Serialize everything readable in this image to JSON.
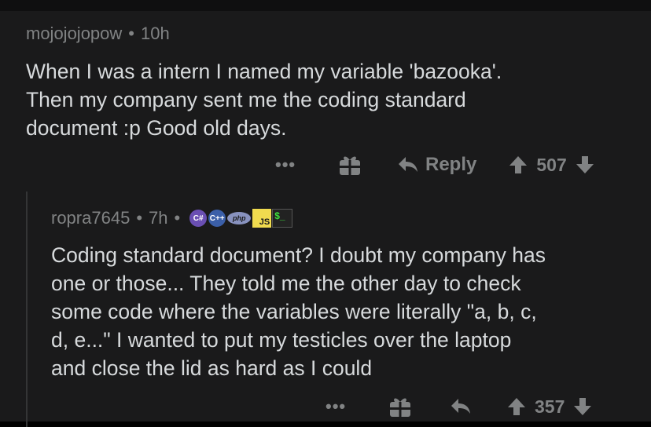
{
  "comment1": {
    "username": "mojojojopow",
    "separator": "•",
    "time": "10h",
    "lines": [
      "When I was a intern I named my variable 'bazooka'.",
      "Then my company sent me the coding standard",
      "document :p Good old days."
    ],
    "more_label": "•••",
    "reply_label": "Reply",
    "score": "507"
  },
  "comment2": {
    "username": "ropra7645",
    "separator": "•",
    "time": "7h",
    "flair": {
      "csharp": "C#",
      "cpp": "C++",
      "php": "php",
      "js": "JS",
      "terminal": "$_"
    },
    "lines": [
      "Coding standard document? I doubt my company has",
      "one or those... They  told me the other day to check",
      "some code where the variables were literally \"a, b, c,",
      "d, e...\" I wanted to put my testicles over the laptop",
      "and close the lid as hard as I could"
    ],
    "more_label": "•••",
    "score": "357"
  },
  "colors": {
    "background": "#1a1a1b",
    "text": "#d7dadc",
    "muted": "#818384"
  }
}
